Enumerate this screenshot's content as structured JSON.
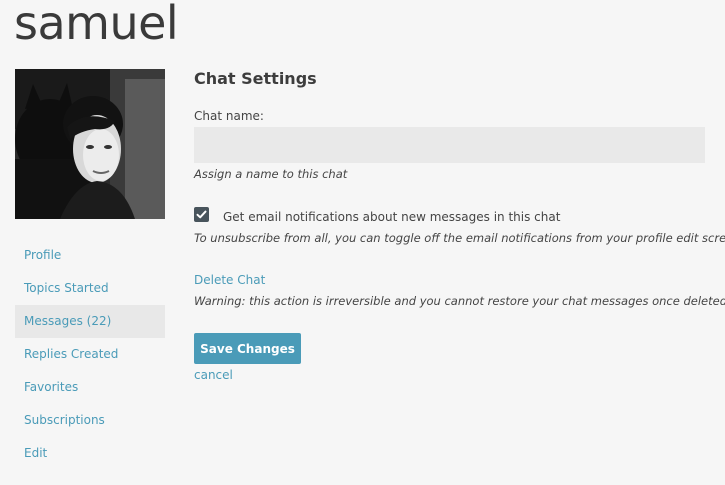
{
  "header": {
    "username": "samuel"
  },
  "sidebar": {
    "items": [
      {
        "label": "Profile",
        "active": false
      },
      {
        "label": "Topics Started",
        "active": false
      },
      {
        "label": "Messages (22)",
        "active": true
      },
      {
        "label": "Replies Created",
        "active": false
      },
      {
        "label": "Favorites",
        "active": false
      },
      {
        "label": "Subscriptions",
        "active": false
      },
      {
        "label": "Edit",
        "active": false
      }
    ]
  },
  "settings": {
    "title": "Chat Settings",
    "chat_name_label": "Chat name:",
    "chat_name_value": "",
    "chat_name_hint": "Assign a name to this chat",
    "email_checkbox_checked": true,
    "email_checkbox_label": "Get email notifications about new messages in this chat",
    "unsubscribe_hint": "To unsubscribe from all, you can toggle off the email notifications from your profile edit screen.",
    "delete_label": "Delete Chat",
    "delete_warning": "Warning: this action is irreversible and you cannot restore your chat messages once deleted.",
    "save_label": "Save Changes",
    "cancel_label": "cancel"
  },
  "icons": {
    "checkbox": "check-icon"
  },
  "colors": {
    "accent": "#4a9bb8",
    "background": "#f6f6f6",
    "active_item_bg": "#e8e8e8",
    "input_bg": "#e9e9e9",
    "checkbox_bg": "#48545c"
  }
}
